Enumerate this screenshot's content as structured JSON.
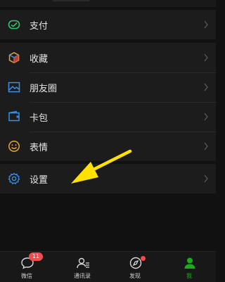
{
  "menu": {
    "pay": {
      "label": "支付",
      "icon": "pay-check-icon"
    },
    "favorites": {
      "label": "收藏",
      "icon": "cube-favorites-icon"
    },
    "moments": {
      "label": "朋友圈",
      "icon": "picture-moments-icon"
    },
    "cards": {
      "label": "卡包",
      "icon": "card-wallet-icon"
    },
    "stickers": {
      "label": "表情",
      "icon": "smiley-face-icon"
    },
    "settings": {
      "label": "设置",
      "icon": "gear-icon"
    }
  },
  "tabbar": {
    "chats": {
      "label": "微信",
      "badge": "11",
      "icon": "chat-bubble-icon"
    },
    "contacts": {
      "label": "通讯录",
      "icon": "contacts-icon"
    },
    "discover": {
      "label": "发现",
      "icon": "compass-icon"
    },
    "me": {
      "label": "我",
      "icon": "person-icon",
      "active": true
    }
  },
  "colors": {
    "accent_green": "#1aad19",
    "pay_green": "#32c46b",
    "orange": "#e8a23a",
    "blue": "#3d8fe0",
    "yellow_arrow": "#ffe100",
    "badge_red": "#f14c4c"
  }
}
